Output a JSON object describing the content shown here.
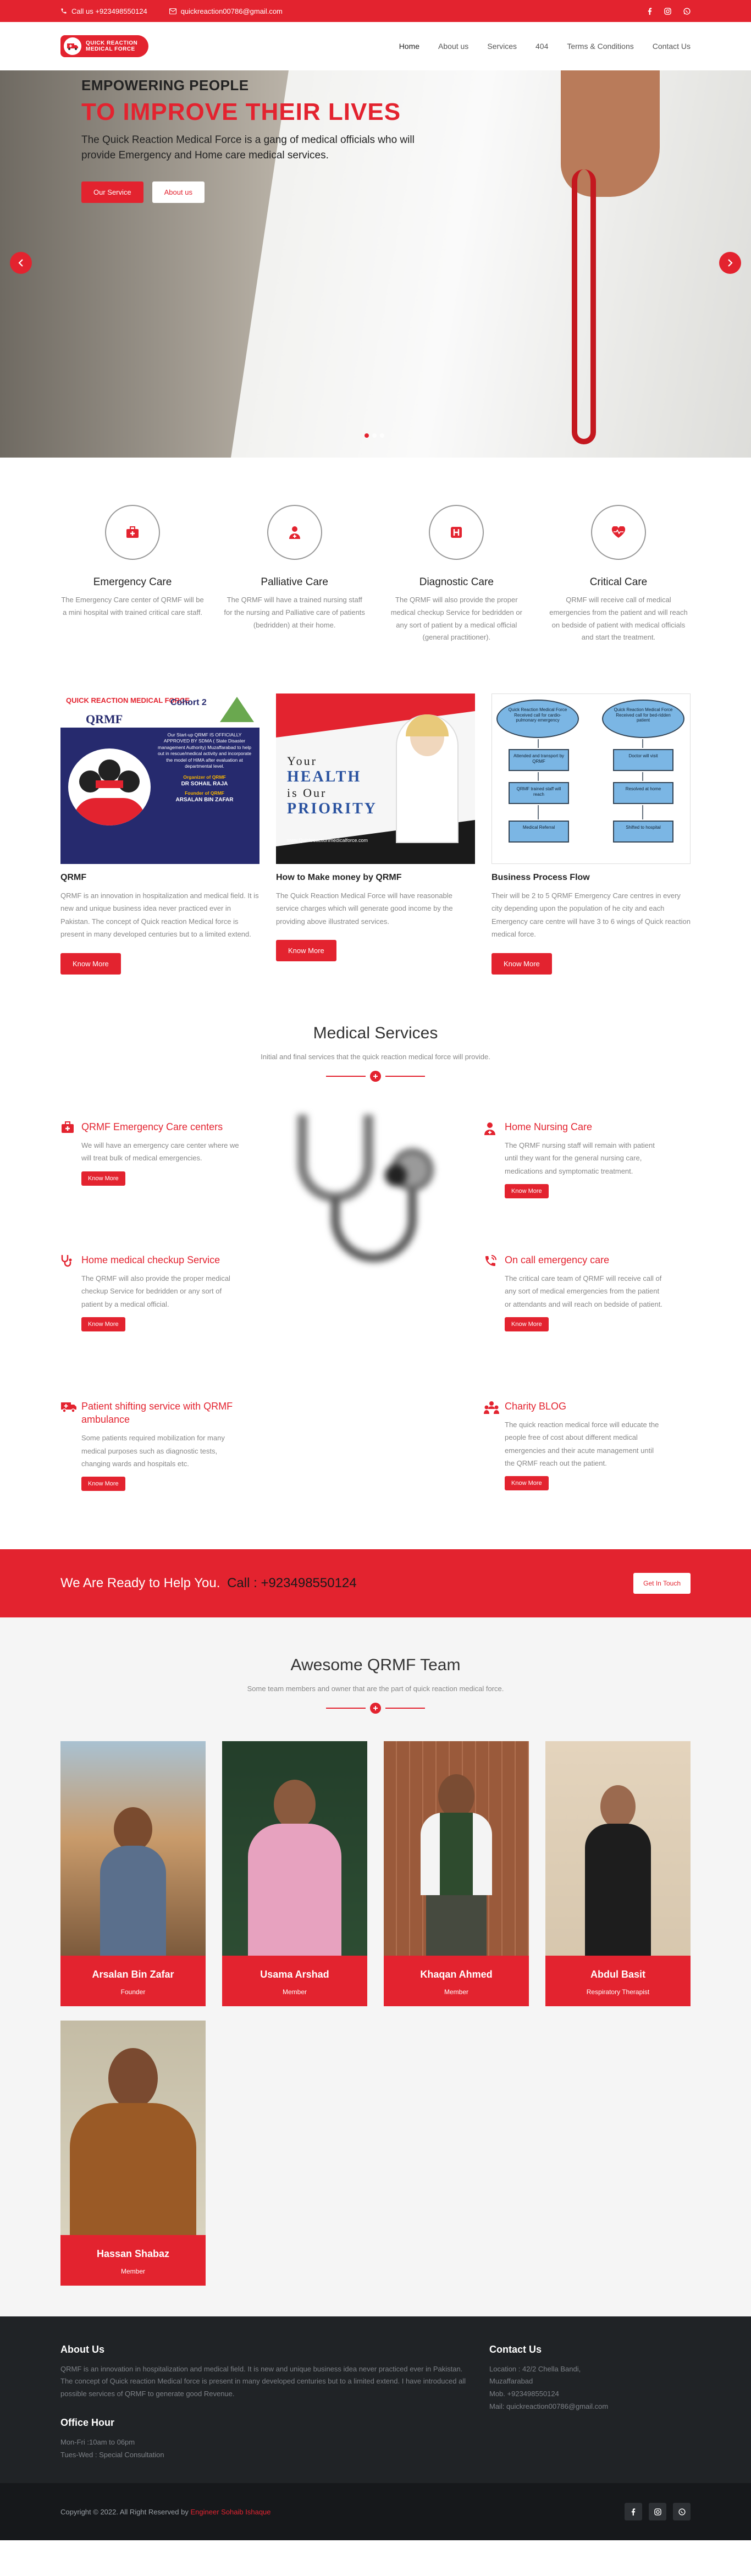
{
  "topbar": {
    "phone": "Call us +923498550124",
    "email": "quickreaction00786@gmail.com"
  },
  "logo": {
    "text": "QUICK REACTION MEDICAL FORCE"
  },
  "nav": [
    "Home",
    "About us",
    "Services",
    "404",
    "Terms & Conditions",
    "Contact Us"
  ],
  "hero": {
    "subtitle": "EMPOWERING PEOPLE",
    "title": "TO IMPROVE THEIR LIVES",
    "desc": "The Quick Reaction Medical Force is a gang of medical officials who will provide Emergency and Home care medical services.",
    "btn1": "Our Service",
    "btn2": "About us"
  },
  "services4": [
    {
      "title": "Emergency Care",
      "text": "The Emergency Care center of QRMF will be a mini hospital with trained critical care staff.",
      "icon": "first-aid-kit-icon"
    },
    {
      "title": "Palliative Care",
      "text": "The QRMF will have a trained nursing staff for the nursing and Palliative care of patients (bedridden) at their home.",
      "icon": "nurse-icon"
    },
    {
      "title": "Diagnostic Care",
      "text": "The QRMF will also provide the proper medical checkup Service for bedridden or any sort of patient by a medical official (general practitioner).",
      "icon": "hospital-icon"
    },
    {
      "title": "Critical Care",
      "text": "QRMF will receive call of medical emergencies from the patient and will reach on bedside of patient with medical officials and start the treatment.",
      "icon": "heartbeat-icon"
    }
  ],
  "blog": [
    {
      "title": "QRMF",
      "text": "QRMF is an innovation in hospitalization and medical field. It is new and unique business idea never practiced ever in Pakistan. The concept of Quick reaction Medical force is present in many developed centuries but to a limited extend.",
      "btn": "Know More",
      "img": {
        "brand": "QUICK REACTION MEDICAL FORCE",
        "name": "QRMF",
        "cohort": "Cohort 2",
        "p1": "Our Start-up QRMF IS OFFICIALLY APPROVED BY SDMA ( State Disaster management Authority) Muzaffarabad to help out  in rescue/medical activity and incorporate the model of HiMA after evaluation at departmental level.",
        "p2": "Organizer of QRMF",
        "p3": "DR SOHAIL RAJA",
        "p4": "Founder of QRMF",
        "p5": "ARSALAN BIN ZAFAR"
      }
    },
    {
      "title": "How to Make money by QRMF",
      "text": "The Quick Reaction Medical Force will have reasonable service charges which will generate good income by the providing above illustrated services.",
      "btn": "Know More",
      "img": {
        "l1": "Your",
        "l2": "HEALTH",
        "l3": "is Our",
        "l4": "PRIORITY",
        "url": "www.Quickreactionmedicalforce.com"
      }
    },
    {
      "title": "Business Process Flow",
      "text": "Their will be 2 to 5 QRMF Emergency Care centres in every city depending upon the population of he city and each Emergency care centre will have 3 to 6 wings of Quick reaction medical force.",
      "btn": "Know More",
      "img": {
        "a": "Quick Reaction Medical Force Received call for cardio-pulmonary emergency",
        "b": "Quick Reaction Medical Force Received call for bed-ridden patient",
        "c": "Attended and transport by QRMF",
        "d": "Doctor will visit",
        "e": "QRMF trained staff will reach",
        "f": "Resolved at home",
        "g": "Medical Referral",
        "h": "Shifted to hospital"
      }
    }
  ],
  "medical": {
    "title": "Medical Services",
    "sub": "Initial and final services that the quick reaction medical force will provide.",
    "items": [
      {
        "title": "QRMF Emergency Care centers",
        "text": "We will have an emergency care center where we will treat bulk of medical emergencies.",
        "btn": "Know More",
        "icon": "first-aid-kit-icon"
      },
      {
        "title": "Home medical checkup Service",
        "text": "The QRMF will also provide the proper medical checkup Service for bedridden or any sort of patient by a medical official.",
        "btn": "Know More",
        "icon": "stethoscope-icon"
      },
      {
        "title": "Patient shifting service with QRMF ambulance",
        "text": "Some patients required mobilization for many medical purposes such as diagnostic tests, changing wards and hospitals etc.",
        "btn": "Know More",
        "icon": "ambulance-icon"
      },
      {
        "title": "Home Nursing Care",
        "text": "The QRMF nursing staff will remain with patient until they want for the general nursing care, medications and symptomatic treatment.",
        "btn": "Know More",
        "icon": "nurse-icon"
      },
      {
        "title": "On call emergency care",
        "text": "The critical care team of QRMF will receive call of any sort of medical emergencies from the patient or attendants and will reach on bedside of patient.",
        "btn": "Know More",
        "icon": "phone-call-icon"
      },
      {
        "title": "Charity BLOG",
        "text": "The quick reaction medical force will educate the people free of cost about different medical emergencies and their acute management until the QRMF reach out the patient.",
        "btn": "Know More",
        "icon": "people-icon"
      }
    ]
  },
  "cta": {
    "text": "We Are Ready to Help You.",
    "phone": "Call : +923498550124",
    "btn": "Get In Touch"
  },
  "team": {
    "title": "Awesome QRMF Team",
    "sub": "Some team members and owner that are the part of quick reaction medical force.",
    "members": [
      {
        "name": "Arsalan Bin Zafar",
        "role": "Founder"
      },
      {
        "name": "Usama Arshad",
        "role": "Member"
      },
      {
        "name": "Khaqan Ahmed",
        "role": "Member"
      },
      {
        "name": "Abdul Basit",
        "role": "Respiratory Therapist"
      },
      {
        "name": "Hassan Shabaz",
        "role": "Member"
      }
    ]
  },
  "footer": {
    "about_title": "About Us",
    "about_text": "QRMF is an innovation in hospitalization and medical field. It is new and unique business idea never practiced ever in Pakistan. The concept of Quick reaction Medical force is present in many developed centuries but to a limited extend. I have introduced all possible services of QRMF to generate good Revenue.",
    "hour_title": "Office Hour",
    "hour1": "Mon-Fri :10am to 06pm",
    "hour2": "Tues-Wed : Special Consultation",
    "contact_title": "Contact Us",
    "address": "Location : 42/2 Chella Bandi, Muzaffarabad",
    "mob": "Mob. +923498550124",
    "mail": "Mail: quickreaction00786@gmail.com"
  },
  "bottom": {
    "copy": "Copyright © 2022. All Right Reserved by",
    "author": "Engineer Sohaib Ishaque"
  },
  "colors": {
    "accent": "#e3232f",
    "dark": "#202326"
  }
}
